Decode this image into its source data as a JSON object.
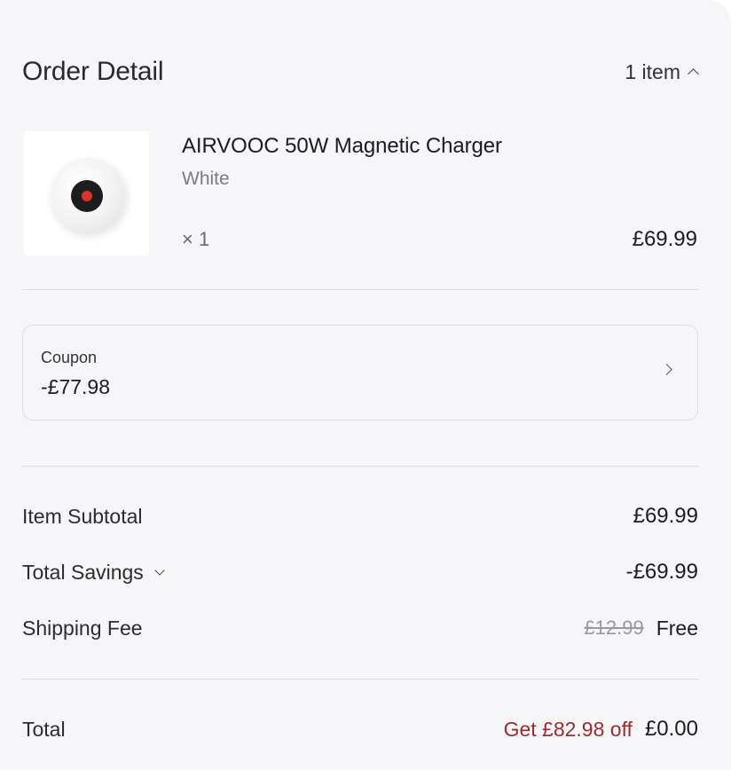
{
  "header": {
    "title": "Order Detail",
    "item_count": "1 item"
  },
  "product": {
    "name": "AIRVOOC 50W Magnetic Charger",
    "variant": "White",
    "quantity": "× 1",
    "price": "£69.99",
    "image_icon": "magnetic-charger-puck"
  },
  "coupon": {
    "label": "Coupon",
    "value": "-£77.98"
  },
  "summary": {
    "subtotal_label": "Item Subtotal",
    "subtotal_value": "£69.99",
    "savings_label": "Total Savings",
    "savings_value": "-£69.99",
    "shipping_label": "Shipping Fee",
    "shipping_original": "£12.99",
    "shipping_value": "Free",
    "total_label": "Total",
    "total_discount": "Get £82.98 off",
    "total_value": "£0.00"
  },
  "colors": {
    "background": "#f6f6f8",
    "discount_text": "#9b2c2c",
    "accent_red_dot": "#e0302b"
  }
}
